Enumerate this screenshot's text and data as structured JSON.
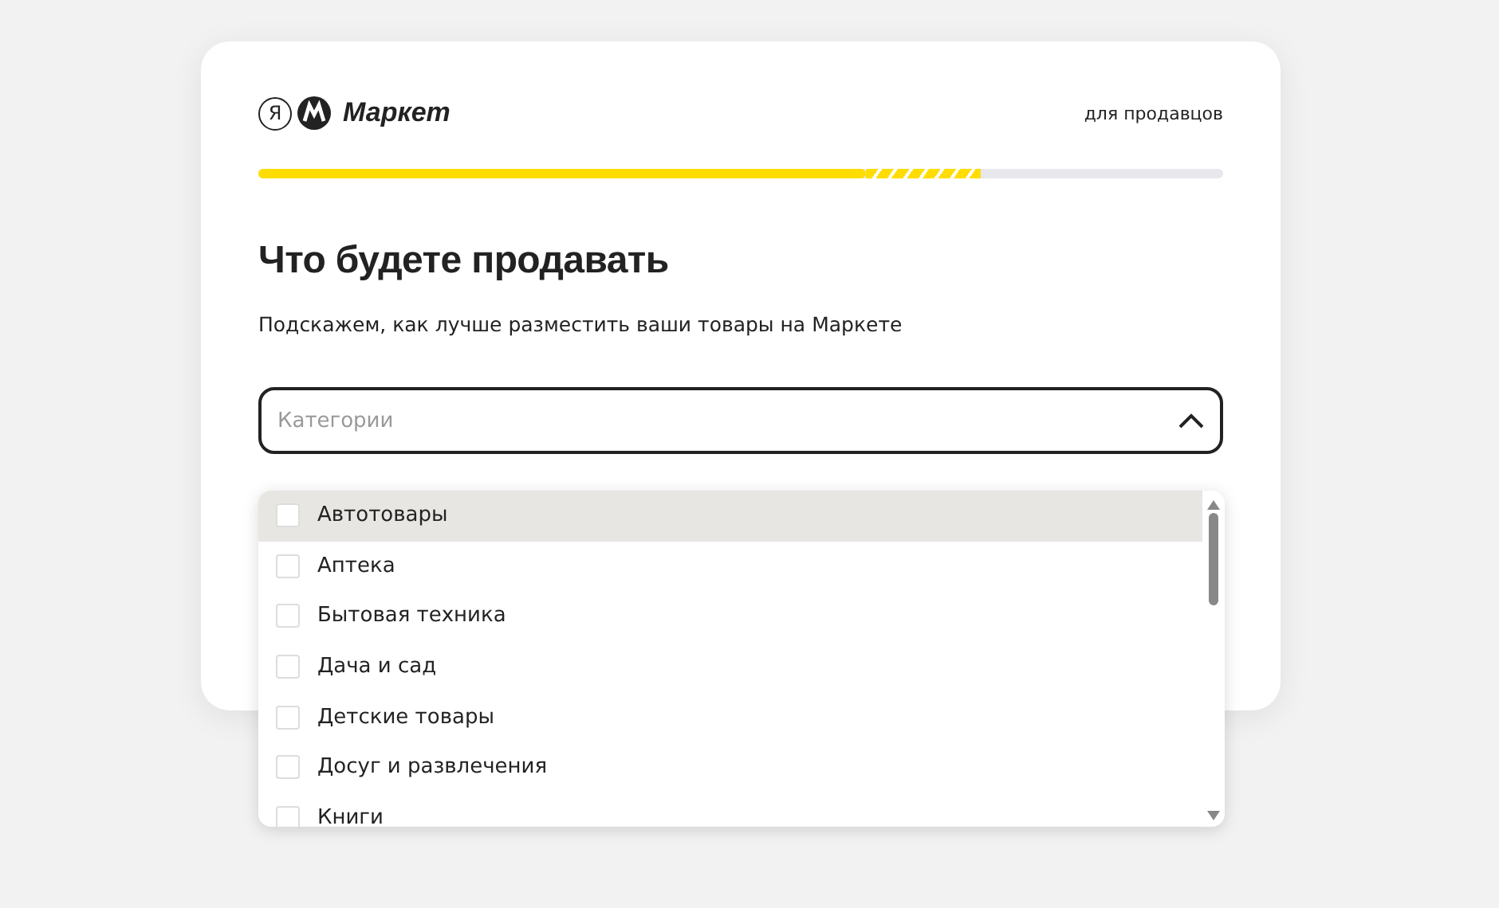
{
  "header": {
    "logo_letter": "Я",
    "brand": "Маркет",
    "seller_link": "для продавцов"
  },
  "progress": {
    "level": 0.63
  },
  "title": "Что будете продавать",
  "subtitle": "Подскажем, как лучше разместить ваши товары на Маркете",
  "category_field": {
    "placeholder": "Категории",
    "expanded": true
  },
  "options": [
    {
      "label": "Автотовары",
      "checked": false,
      "hovered": true
    },
    {
      "label": "Аптека",
      "checked": false,
      "hovered": false
    },
    {
      "label": "Бытовая техника",
      "checked": false,
      "hovered": false
    },
    {
      "label": "Дача и сад",
      "checked": false,
      "hovered": false
    },
    {
      "label": "Детские товары",
      "checked": false,
      "hovered": false
    },
    {
      "label": "Досуг и развлечения",
      "checked": false,
      "hovered": false
    },
    {
      "label": "Книги",
      "checked": false,
      "hovered": false
    }
  ]
}
